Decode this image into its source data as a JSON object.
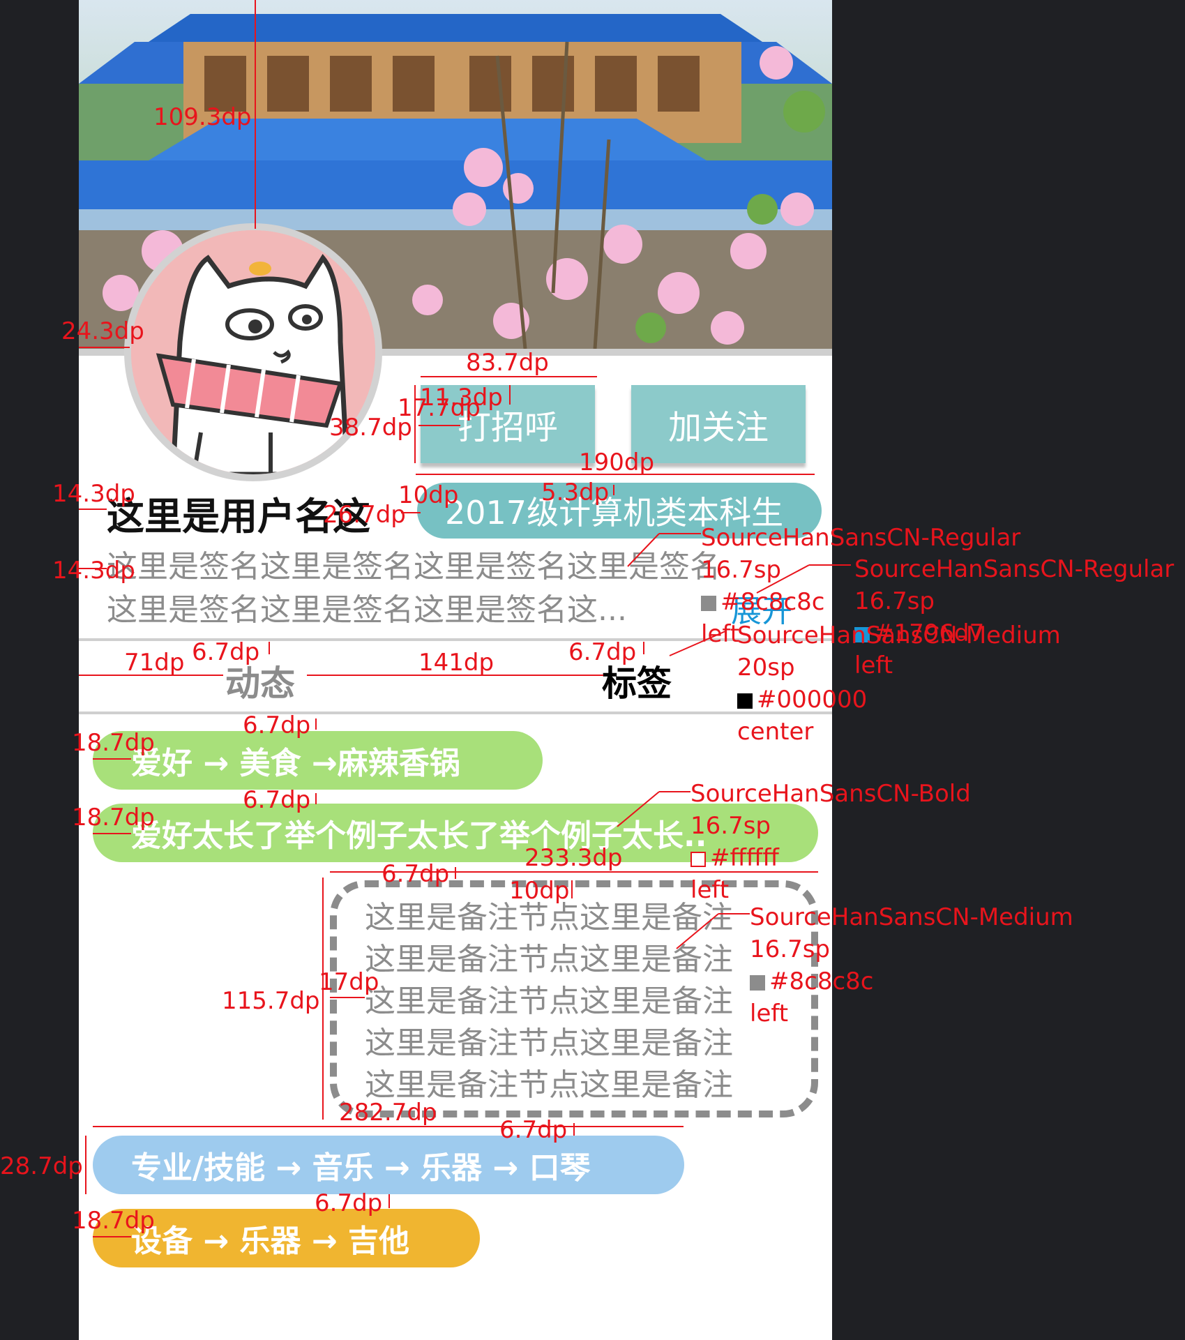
{
  "profile": {
    "buttons": {
      "hello": "打招呼",
      "follow": "加关注"
    },
    "username": "这里是用户名这",
    "class_badge": "2017级计算机类本科生",
    "signature_lines": [
      "这里是签名这里是签名这里是签名这里是签名",
      "这里是签名这里是签名这里是签名这..."
    ],
    "expand": "展开"
  },
  "tabs": {
    "dynamic": "动态",
    "tags": "标签"
  },
  "tags": [
    "爱好 → 美食 →麻辣香锅",
    "爱好太长了举个例子太长了举个例子太长..",
    "专业/技能 → 音乐 → 乐器 → 口琴",
    "设备 → 乐器 → 吉他"
  ],
  "note_lines": [
    "这里是备注节点这里是备注",
    "这里是备注节点这里是备注",
    "这里是备注节点这里是备注",
    "这里是备注节点这里是备注",
    "这里是备注节点这里是备注"
  ],
  "colors": {
    "button_bg": "#8ccaca",
    "badge_bg": "#77c1c3",
    "tag_green": "#a8e07a",
    "tag_blue": "#9ecbee",
    "tag_orange": "#f0b530",
    "signature": "#8c8c8c",
    "expand": "#1796d7",
    "annotation": "#e8141c"
  },
  "annotations": {
    "dims": [
      "109.3dp",
      "24.3dp",
      "83.7dp",
      "11.3dp",
      "17.7dp",
      "38.7dp",
      "190dp",
      "14.3dp",
      "10dp",
      "5.3dp",
      "26.7dp",
      "14.3dp",
      "71dp",
      "6.7dp",
      "141dp",
      "6.7dp",
      "6.7dp",
      "18.7dp",
      "6.7dp",
      "18.7dp",
      "233.3dp",
      "6.7dp",
      "10dp",
      "17dp",
      "115.7dp",
      "282.7dp",
      "6.7dp",
      "28.7dp",
      "6.7dp",
      "18.7dp"
    ],
    "specs": {
      "signature": [
        "SourceHanSansCN-Regular",
        "16.7sp",
        "#8c8c8c",
        "left"
      ],
      "expand": [
        "SourceHanSansCN-Regular",
        "16.7sp",
        "#1796d7",
        "left"
      ],
      "tab": [
        "SourceHanSansCN-Medium",
        "20sp",
        "#000000",
        "center"
      ],
      "tag": [
        "SourceHanSansCN-Bold",
        "16.7sp",
        "#ffffff",
        "left"
      ],
      "note": [
        "SourceHanSansCN-Medium",
        "16.7sp",
        "#8c8c8c",
        "left"
      ]
    }
  }
}
